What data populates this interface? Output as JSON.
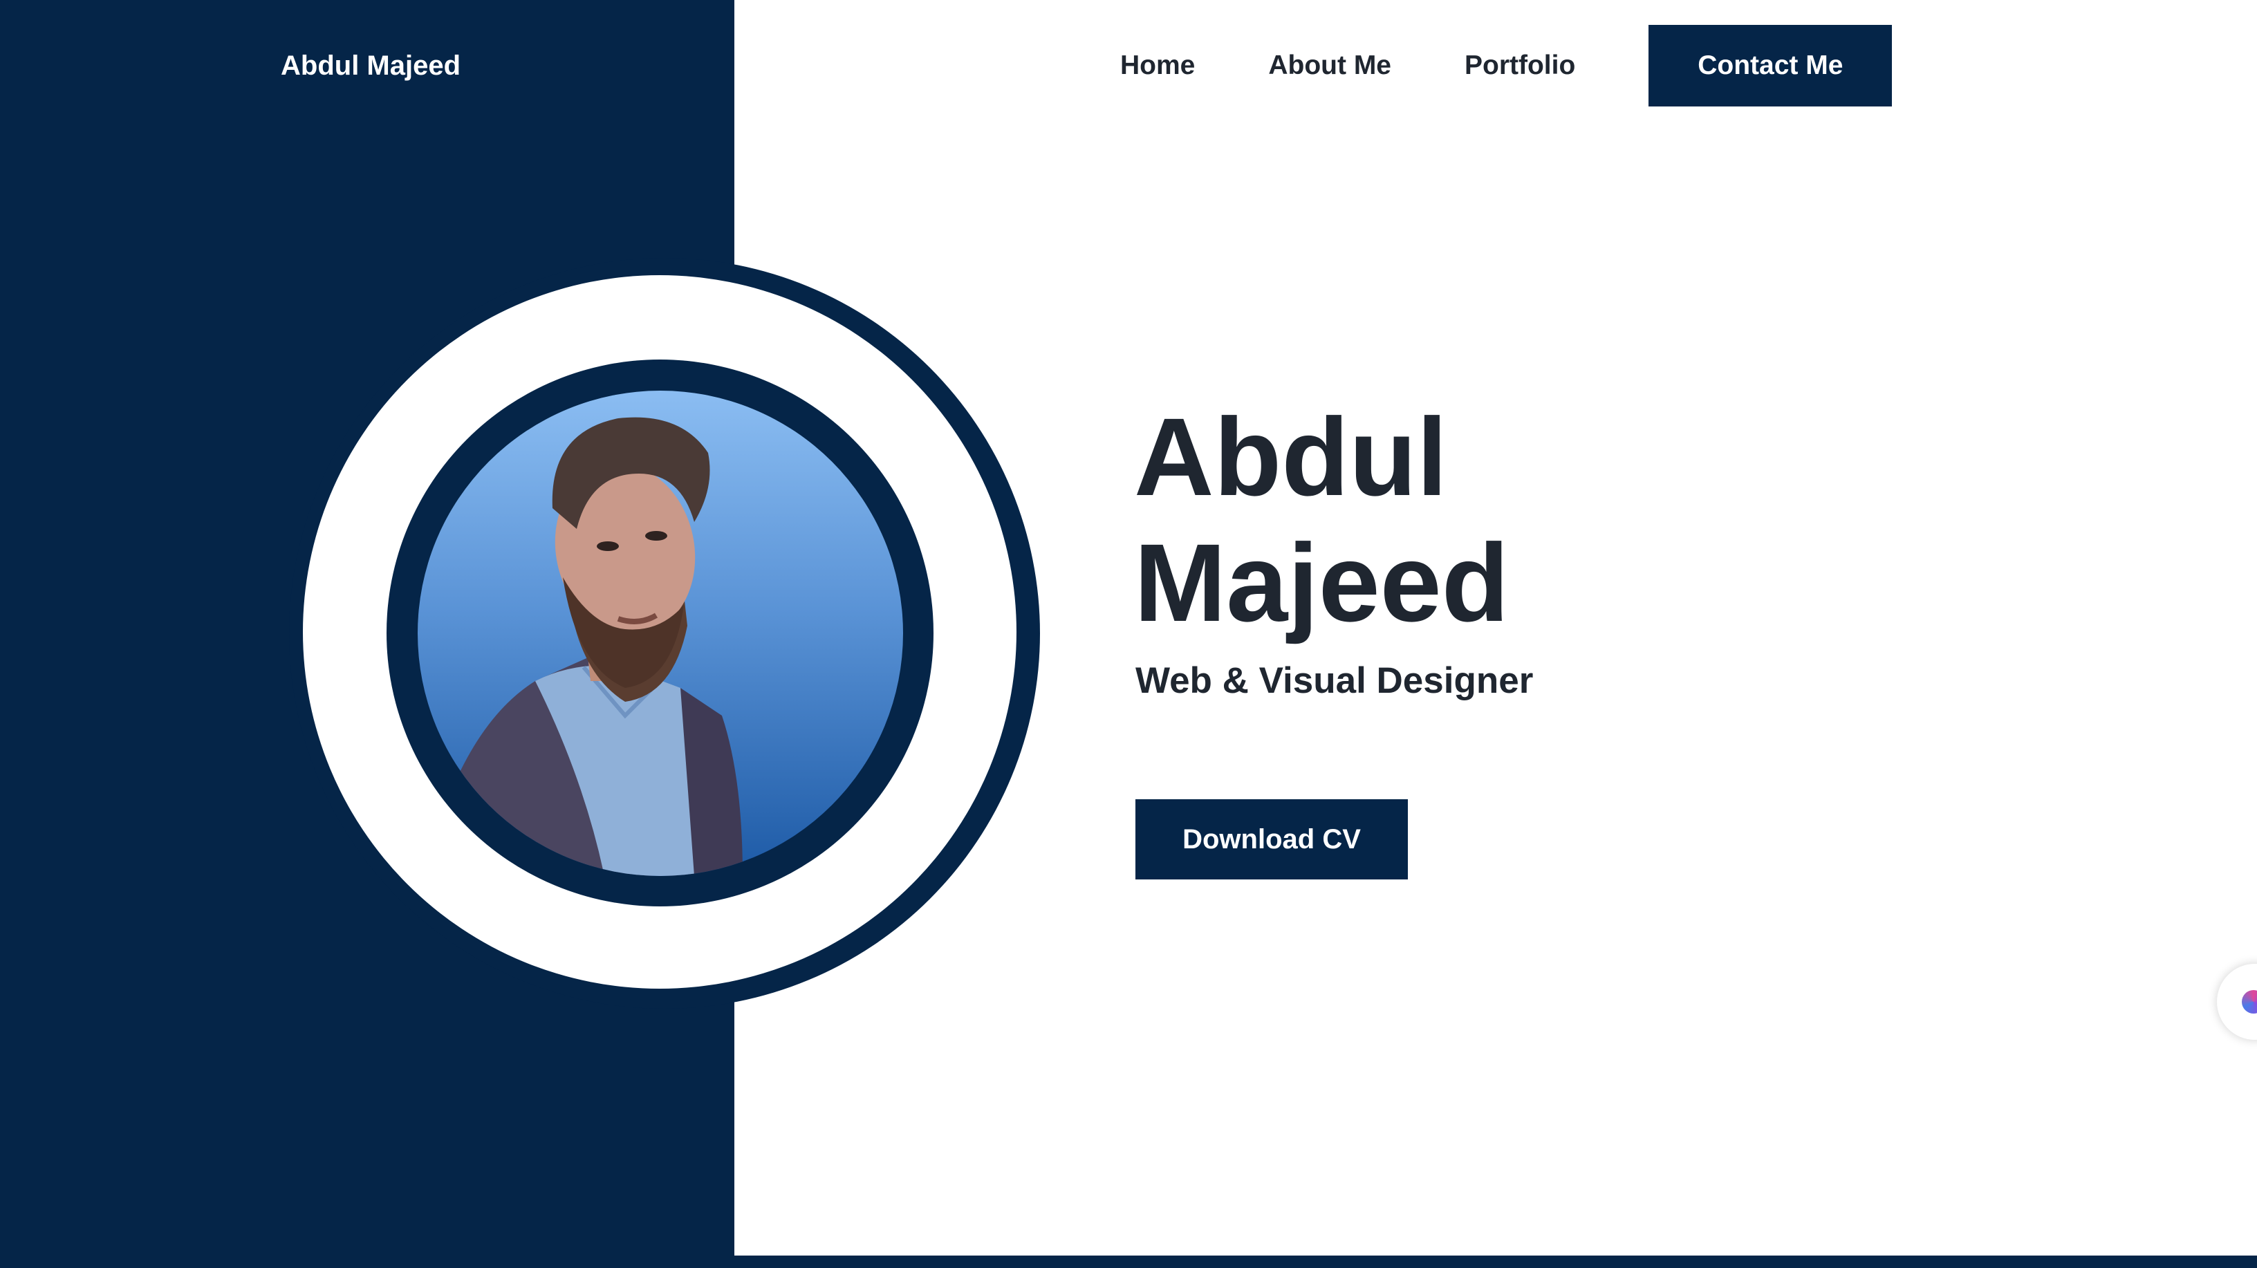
{
  "header": {
    "brand": "Abdul Majeed",
    "nav": [
      {
        "label": "Home"
      },
      {
        "label": "About Me"
      },
      {
        "label": "Portfolio"
      }
    ],
    "contact_label": "Contact Me"
  },
  "hero": {
    "first_name": "Abdul",
    "last_name": "Majeed",
    "role": "Web & Visual Designer",
    "download_label": "Download CV",
    "photo_icon": "profile-photo"
  },
  "colors": {
    "primary": "#052548",
    "text": "#1f2630",
    "background": "#ffffff"
  },
  "floating_widget_icon": "assistant-icon"
}
